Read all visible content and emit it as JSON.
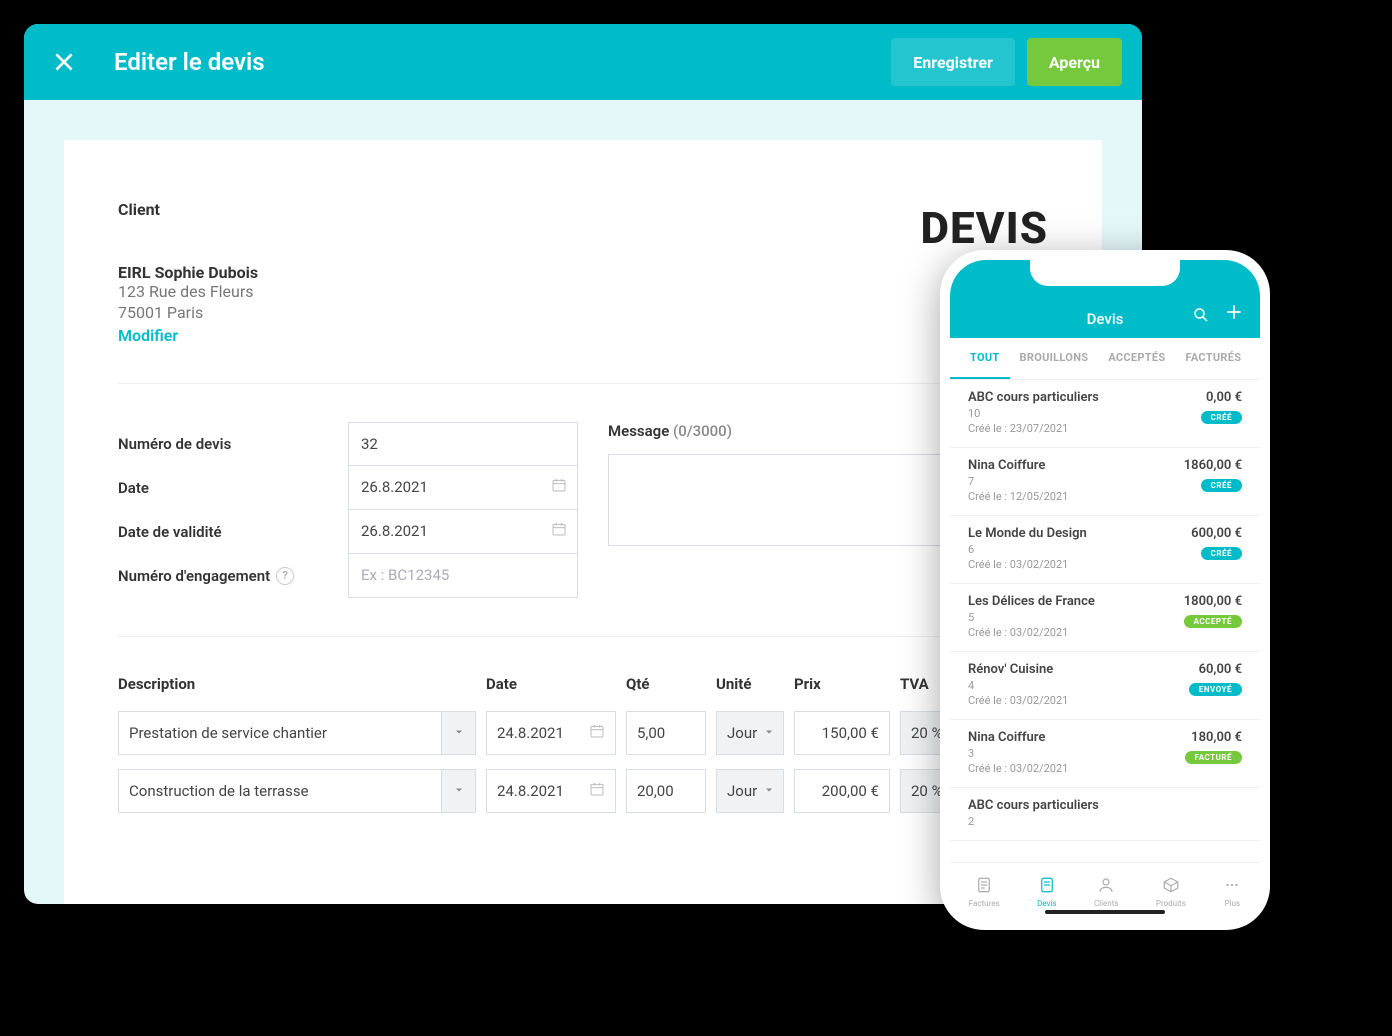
{
  "window": {
    "title": "Editer le devis",
    "save_label": "Enregistrer",
    "preview_label": "Aperçu"
  },
  "doc": {
    "doc_type": "DEVIS",
    "client_section_label": "Client",
    "client": {
      "name": "EIRL Sophie Dubois",
      "street": "123 Rue des Fleurs",
      "city": "75001 Paris"
    },
    "modify_link": "Modifier",
    "fields": {
      "number_label": "Numéro de devis",
      "number_value": "32",
      "date_label": "Date",
      "date_value": "26.8.2021",
      "validity_label": "Date de validité",
      "validity_value": "26.8.2021",
      "engagement_label": "Numéro d'engagement",
      "engagement_placeholder": "Ex : BC12345"
    },
    "message": {
      "label": "Message",
      "count": "(0/3000)"
    },
    "columns": {
      "description": "Description",
      "date": "Date",
      "qty": "Qté",
      "unit": "Unité",
      "price": "Prix",
      "vat": "TVA"
    },
    "lines": [
      {
        "description": "Prestation de service chantier",
        "date": "24.8.2021",
        "qty": "5,00",
        "unit": "Jour",
        "price": "150,00 €",
        "vat": "20 %"
      },
      {
        "description": "Construction de la terrasse",
        "date": "24.8.2021",
        "qty": "20,00",
        "unit": "Jour",
        "price": "200,00 €",
        "vat": "20 %"
      }
    ]
  },
  "phone": {
    "header_title": "Devis",
    "tabs": [
      "TOUT",
      "BROUILLONS",
      "ACCEPTÉS",
      "FACTURÉS"
    ],
    "active_tab": 0,
    "list": [
      {
        "name": "ABC cours particuliers",
        "id": "10",
        "date": "Créé le : 23/07/2021",
        "amount": "0,00 €",
        "status": "CRÉÉ",
        "status_class": "cree"
      },
      {
        "name": "Nina Coiffure",
        "id": "7",
        "date": "Créé le : 12/05/2021",
        "amount": "1860,00 €",
        "status": "CRÉÉ",
        "status_class": "cree"
      },
      {
        "name": "Le Monde du Design",
        "id": "6",
        "date": "Créé le : 03/02/2021",
        "amount": "600,00 €",
        "status": "CRÉÉ",
        "status_class": "cree"
      },
      {
        "name": " Les Délices de France",
        "id": "5",
        "date": "Créé le : 03/02/2021",
        "amount": "1800,00 €",
        "status": "ACCEPTÉ",
        "status_class": "accepte"
      },
      {
        "name": "Rénov' Cuisine",
        "id": "4",
        "date": "Créé le : 03/02/2021",
        "amount": "60,00 €",
        "status": "ENVOYÉ",
        "status_class": "envoye"
      },
      {
        "name": "Nina Coiffure",
        "id": "3",
        "date": "Créé le : 03/02/2021",
        "amount": "180,00 €",
        "status": "FACTURÉ",
        "status_class": "facture"
      },
      {
        "name": "ABC cours particuliers",
        "id": "2",
        "date": "",
        "amount": "",
        "status": "",
        "status_class": ""
      }
    ],
    "nav": [
      {
        "label": "Factures",
        "icon": "invoice"
      },
      {
        "label": "Devis",
        "icon": "quote"
      },
      {
        "label": "Clients",
        "icon": "person"
      },
      {
        "label": "Produits",
        "icon": "box"
      },
      {
        "label": "Plus",
        "icon": "more"
      }
    ],
    "active_nav": 1
  }
}
